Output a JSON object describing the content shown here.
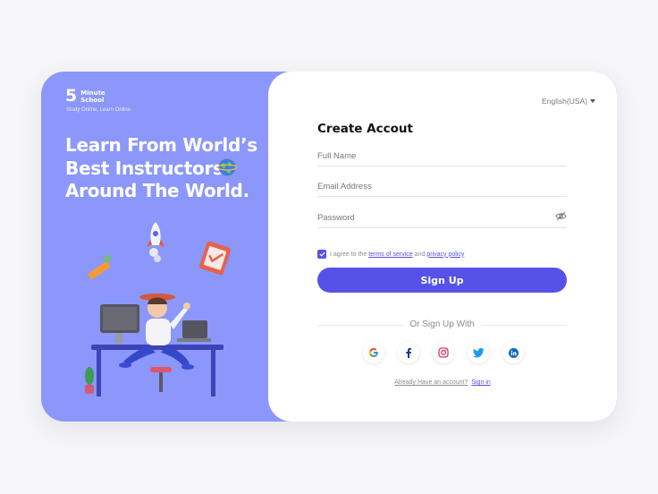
{
  "brand": {
    "number": "5",
    "name": "Minute School",
    "tagline": "Study Online, Learn Online"
  },
  "hero": {
    "line1": "Learn From World’s",
    "line2": "Best Instructors",
    "line3": "Around The World."
  },
  "language": {
    "label": "English(USA)"
  },
  "form": {
    "title": "Create Accout",
    "full_name_placeholder": "Full Name",
    "email_placeholder": "Email Address",
    "password_placeholder": "Password",
    "agree_prefix": "I agree to the",
    "terms_link": "terms of service",
    "and_text": "and",
    "privacy_link": "privacy policy",
    "signup_label": "Sign Up",
    "divider_text": "Or Sign Up With",
    "already_text": "Already Have an account?",
    "signin_link": "Sign in"
  },
  "socials": [
    "google-icon",
    "facebook-icon",
    "instagram-icon",
    "twitter-icon",
    "linkedin-icon"
  ],
  "colors": {
    "panel": "#8b97fa",
    "accent": "#5652e8",
    "background": "#f6f6f8"
  }
}
